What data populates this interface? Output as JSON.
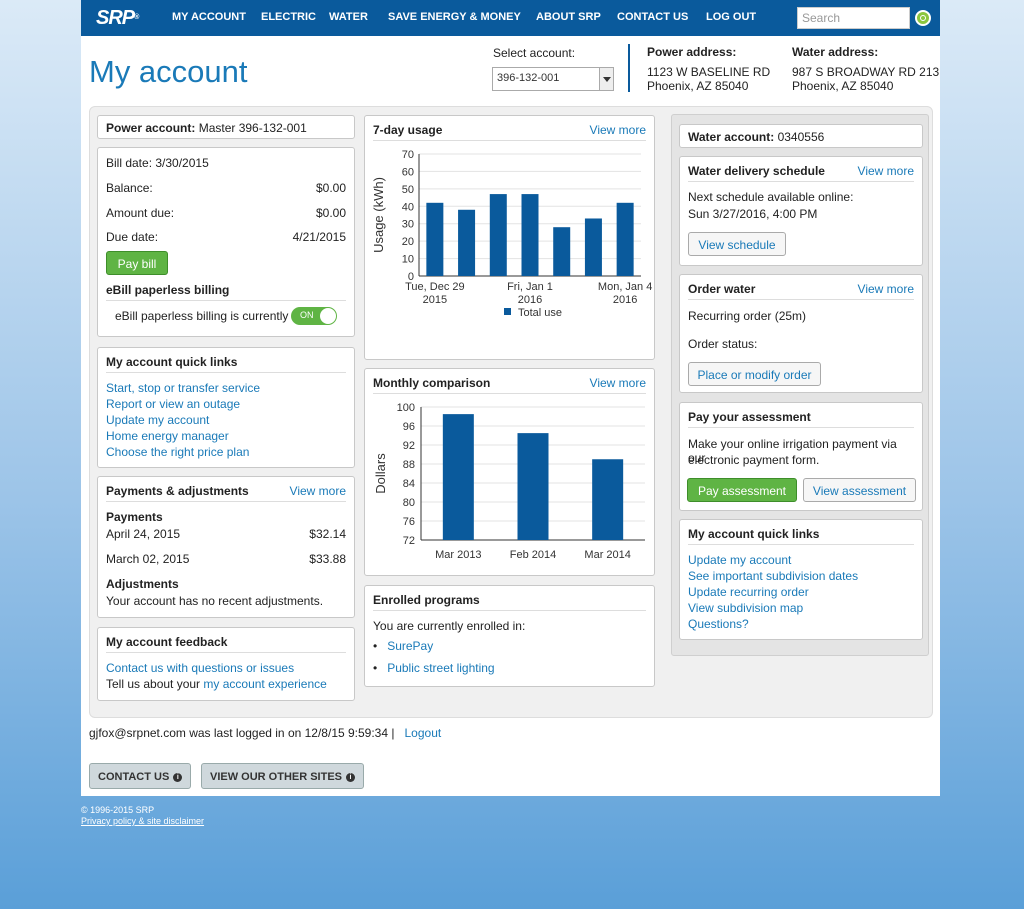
{
  "nav": {
    "logo": "SRP",
    "items": [
      "MY ACCOUNT",
      "ELECTRIC",
      "WATER",
      "SAVE ENERGY & MONEY",
      "ABOUT SRP",
      "CONTACT US",
      "LOG OUT"
    ],
    "search_placeholder": "Search"
  },
  "header": {
    "title": "My account",
    "select_label": "Select account:",
    "selected_account": "396-132-001",
    "power_label": "Power address:",
    "power_line1": "1123 W BASELINE RD",
    "power_line2": "Phoenix, AZ 85040",
    "water_label": "Water address:",
    "water_line1": "987 S BROADWAY RD 213",
    "water_line2": "Phoenix, AZ 85040"
  },
  "power": {
    "label": "Power account:",
    "value": "Master 396-132-001"
  },
  "bill": {
    "bill_date": "Bill date: 3/30/2015",
    "balance_label": "Balance:",
    "balance": "$0.00",
    "amount_due_label": "Amount due:",
    "amount_due": "$0.00",
    "due_date_label": "Due date:",
    "due_date": "4/21/2015",
    "pay_bill": "Pay bill",
    "ebill_title": "eBill paperless billing",
    "ebill_text": "eBill paperless billing is currently",
    "toggle": "ON"
  },
  "quick_links": {
    "title": "My account quick links",
    "items": [
      "Start, stop or transfer service",
      "Report or view an outage",
      "Update my account",
      "Home energy manager",
      "Choose the right price plan"
    ]
  },
  "payments": {
    "title": "Payments & adjustments",
    "view_more": "View more",
    "payments_label": "Payments",
    "rows": [
      {
        "date": "April 24, 2015",
        "amount": "$32.14"
      },
      {
        "date": "March 02, 2015",
        "amount": "$33.88"
      }
    ],
    "adjustments_label": "Adjustments",
    "adjustments_text": "Your account has no recent adjustments."
  },
  "feedback": {
    "title": "My account feedback",
    "link1": "Contact us with questions or issues",
    "text2": "Tell us about your",
    "link2": "my account experience"
  },
  "usage": {
    "title": "7-day usage",
    "view_more": "View more"
  },
  "monthly": {
    "title": "Monthly comparison",
    "view_more": "View more"
  },
  "enrolled": {
    "title": "Enrolled programs",
    "text": "You are currently enrolled in:",
    "items": [
      "SurePay",
      "Public street lighting"
    ]
  },
  "water_account": {
    "label": "Water account:",
    "value": "0340556"
  },
  "delivery": {
    "title": "Water delivery schedule",
    "view_more": "View more",
    "line1": "Next schedule available online:",
    "line2": "Sun 3/27/2016, 4:00 PM",
    "button": "View schedule"
  },
  "order": {
    "title": "Order water",
    "view_more": "View more",
    "recurring": "Recurring order (25m)",
    "status": "Order status:",
    "button": "Place or modify order"
  },
  "assessment": {
    "title": "Pay your assessment",
    "text1": "Make your online irrigation payment via our",
    "text2": "electronic payment form.",
    "pay": "Pay assessment",
    "view": "View assessment"
  },
  "quick_links2": {
    "title": "My account quick links",
    "items": [
      "Update my account",
      "See important subdivision dates",
      "Update recurring order",
      "View subdivision map",
      "Questions?"
    ]
  },
  "footer": {
    "login_text": "gjfox@srpnet.com was last logged in on 12/8/15 9:59:34 |",
    "logout": "Logout",
    "contact": "CONTACT US",
    "other_sites": "VIEW OUR OTHER SITES",
    "copyright": "© 1996-2015 SRP",
    "privacy": "Privacy policy & site disclaimer"
  },
  "colors": {
    "brand": "#0a5a9c",
    "link": "#1a7ab8",
    "green": "#5fb444",
    "bar": "#0a5a9c"
  },
  "chart_data": [
    {
      "type": "bar",
      "title": "7-day usage",
      "ylabel": "Usage (kWh)",
      "ylim": [
        0,
        70
      ],
      "yticks": [
        0,
        10,
        20,
        30,
        40,
        50,
        60,
        70
      ],
      "x_labels": [
        [
          "Tue, Dec 29",
          "2015"
        ],
        [
          "Fri, Jan 1",
          "2016"
        ],
        [
          "Mon, Jan 4",
          "2016"
        ]
      ],
      "values": [
        42,
        38,
        47,
        47,
        28,
        33,
        42
      ],
      "legend": "Total use"
    },
    {
      "type": "bar",
      "title": "Monthly comparison",
      "ylabel": "Dollars",
      "ylim": [
        72,
        100
      ],
      "yticks": [
        72,
        76,
        80,
        84,
        88,
        92,
        96,
        100
      ],
      "categories": [
        "Mar 2013",
        "Feb 2014",
        "Mar 2014"
      ],
      "values": [
        98.5,
        94.5,
        89
      ]
    }
  ]
}
